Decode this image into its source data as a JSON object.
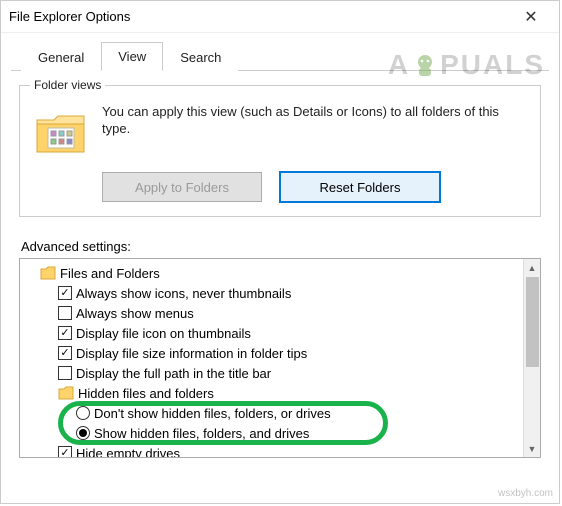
{
  "window": {
    "title": "File Explorer Options"
  },
  "tabs": {
    "general": "General",
    "view": "View",
    "search": "Search"
  },
  "folder_views": {
    "legend": "Folder views",
    "text": "You can apply this view (such as Details or Icons) to all folders of this type.",
    "apply_btn": "Apply to Folders",
    "reset_btn": "Reset Folders"
  },
  "advanced": {
    "label": "Advanced settings:",
    "root": "Files and Folders",
    "items": [
      {
        "label": "Always show icons, never thumbnails",
        "checked": true
      },
      {
        "label": "Always show menus",
        "checked": false
      },
      {
        "label": "Display file icon on thumbnails",
        "checked": true
      },
      {
        "label": "Display file size information in folder tips",
        "checked": true
      },
      {
        "label": "Display the full path in the title bar",
        "checked": false
      }
    ],
    "hidden_group": "Hidden files and folders",
    "hidden_radio": {
      "dont": "Don't show hidden files, folders, or drives",
      "show": "Show hidden files, folders, and drives"
    },
    "hide_empty": {
      "label": "Hide empty drives",
      "checked": true
    }
  },
  "watermark": "A  PUALS",
  "sourcemark": "wsxbyh.com"
}
